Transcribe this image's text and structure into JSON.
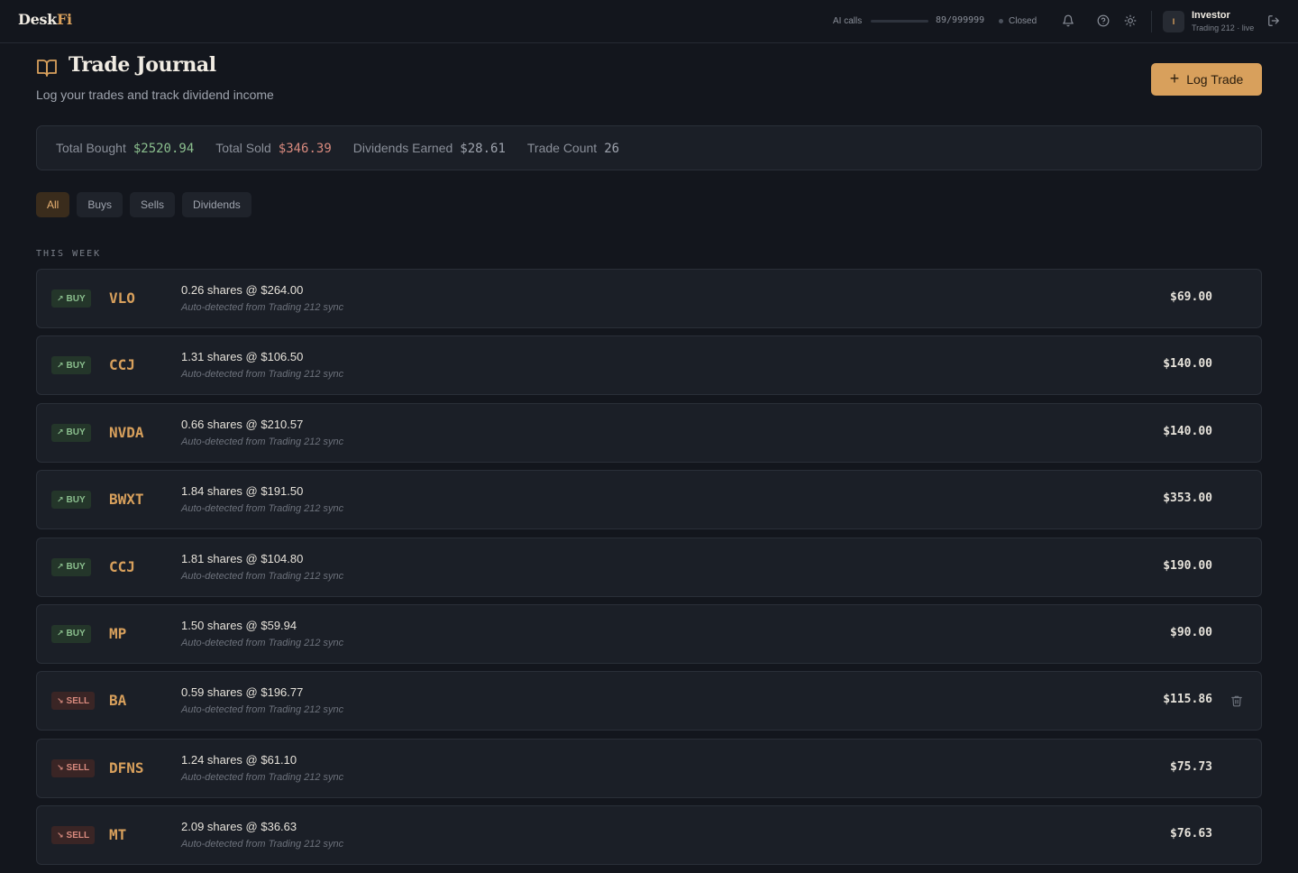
{
  "app": {
    "logo_main": "Desk",
    "logo_accent": "Fi"
  },
  "topbar": {
    "ai_calls_label": "AI calls",
    "ai_calls_count": "89/999999",
    "ai_calls_fraction": 0.0001,
    "market_status": "Closed",
    "user_initial": "I",
    "user_name": "Investor",
    "user_sub": "Trading 212 · live"
  },
  "header": {
    "title": "Trade Journal",
    "subtitle": "Log your trades and track dividend income",
    "log_button": "Log Trade"
  },
  "stats": {
    "total_bought_label": "Total Bought",
    "total_bought": "$2520.94",
    "total_sold_label": "Total Sold",
    "total_sold": "$346.39",
    "dividends_label": "Dividends Earned",
    "dividends": "$28.61",
    "trade_count_label": "Trade Count",
    "trade_count": "26"
  },
  "filters": [
    "All",
    "Buys",
    "Sells",
    "Dividends"
  ],
  "section_label": "THIS WEEK",
  "trades": [
    {
      "type": "buy",
      "badge": "BUY",
      "ticker": "VLO",
      "desc": "0.26 shares @ $264.00",
      "note": "Auto-detected from Trading 212 sync",
      "amount": "$69.00"
    },
    {
      "type": "buy",
      "badge": "BUY",
      "ticker": "CCJ",
      "desc": "1.31 shares @ $106.50",
      "note": "Auto-detected from Trading 212 sync",
      "amount": "$140.00"
    },
    {
      "type": "buy",
      "badge": "BUY",
      "ticker": "NVDA",
      "desc": "0.66 shares @ $210.57",
      "note": "Auto-detected from Trading 212 sync",
      "amount": "$140.00"
    },
    {
      "type": "buy",
      "badge": "BUY",
      "ticker": "BWXT",
      "desc": "1.84 shares @ $191.50",
      "note": "Auto-detected from Trading 212 sync",
      "amount": "$353.00"
    },
    {
      "type": "buy",
      "badge": "BUY",
      "ticker": "CCJ",
      "desc": "1.81 shares @ $104.80",
      "note": "Auto-detected from Trading 212 sync",
      "amount": "$190.00"
    },
    {
      "type": "buy",
      "badge": "BUY",
      "ticker": "MP",
      "desc": "1.50 shares @ $59.94",
      "note": "Auto-detected from Trading 212 sync",
      "amount": "$90.00"
    },
    {
      "type": "sell",
      "badge": "SELL",
      "ticker": "BA",
      "desc": "0.59 shares @ $196.77",
      "note": "Auto-detected from Trading 212 sync",
      "amount": "$115.86",
      "show_delete": true
    },
    {
      "type": "sell",
      "badge": "SELL",
      "ticker": "DFNS",
      "desc": "1.24 shares @ $61.10",
      "note": "Auto-detected from Trading 212 sync",
      "amount": "$75.73"
    },
    {
      "type": "sell",
      "badge": "SELL",
      "ticker": "MT",
      "desc": "2.09 shares @ $36.63",
      "note": "Auto-detected from Trading 212 sync",
      "amount": "$76.63"
    }
  ]
}
